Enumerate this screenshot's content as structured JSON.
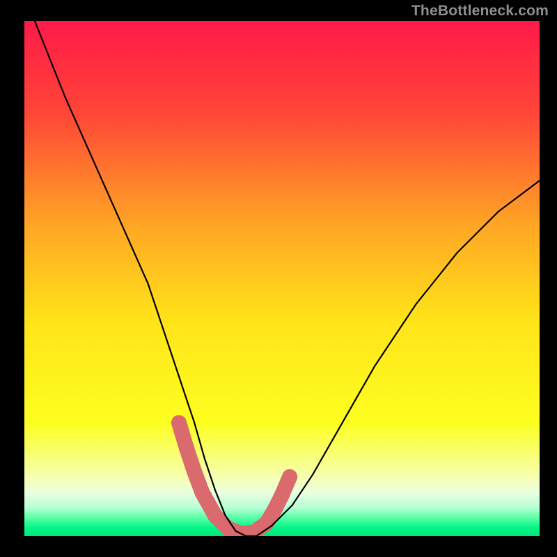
{
  "watermark": "TheBottleneck.com",
  "chart_data": {
    "type": "line",
    "title": "",
    "xlabel": "",
    "ylabel": "",
    "xlim": [
      0,
      100
    ],
    "ylim": [
      0,
      100
    ],
    "gradient_stops": [
      {
        "offset": 0.0,
        "color": "#ff1a49"
      },
      {
        "offset": 0.18,
        "color": "#ff4637"
      },
      {
        "offset": 0.4,
        "color": "#ffa724"
      },
      {
        "offset": 0.58,
        "color": "#ffe319"
      },
      {
        "offset": 0.78,
        "color": "#fdff1f"
      },
      {
        "offset": 0.885,
        "color": "#f6ffb0"
      },
      {
        "offset": 0.915,
        "color": "#eaffdf"
      },
      {
        "offset": 0.945,
        "color": "#b6ffd6"
      },
      {
        "offset": 0.965,
        "color": "#56ffa4"
      },
      {
        "offset": 0.985,
        "color": "#00f585"
      },
      {
        "offset": 1.0,
        "color": "#00e67a"
      }
    ],
    "series": [
      {
        "name": "bottleneck-curve",
        "x": [
          0,
          4,
          8,
          12,
          16,
          20,
          24,
          27,
          30,
          33,
          35,
          37,
          39,
          41,
          43,
          45,
          48,
          52,
          56,
          60,
          64,
          68,
          72,
          76,
          80,
          84,
          88,
          92,
          96,
          100
        ],
        "y": [
          105,
          95,
          85,
          76,
          67,
          58,
          49,
          40,
          31,
          22,
          15,
          9,
          4,
          1,
          0,
          0,
          2,
          6,
          12,
          19,
          26,
          33,
          39,
          45,
          50,
          55,
          59,
          63,
          66,
          69
        ]
      }
    ],
    "markers": {
      "name": "highlight-region",
      "color": "#da6a6d",
      "x": [
        30.0,
        31.5,
        33.0,
        34.5,
        37.0,
        39.5,
        42.0,
        44.5,
        47.0,
        48.5,
        50.0,
        51.5
      ],
      "y": [
        22.0,
        17.0,
        12.5,
        8.5,
        4.0,
        1.5,
        0.5,
        0.7,
        2.5,
        5.0,
        8.0,
        11.5
      ]
    }
  }
}
